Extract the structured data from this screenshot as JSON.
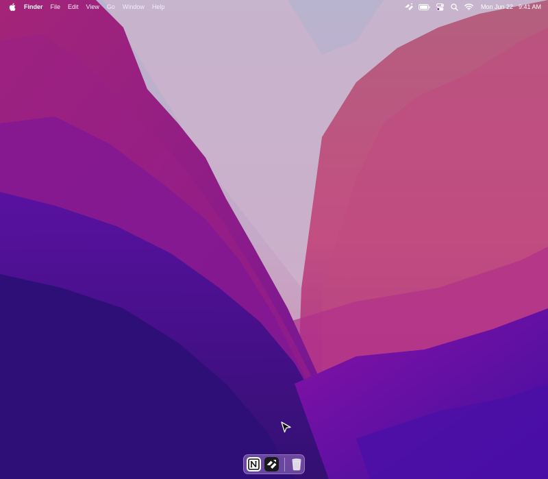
{
  "menubar": {
    "apple_icon": "apple-logo-icon",
    "app_name": "Finder",
    "menus": [
      "File",
      "Edit",
      "View",
      "Go",
      "Window",
      "Help"
    ],
    "status_icons": [
      "pixelmator-icon",
      "battery-icon",
      "control-center-icon",
      "spotlight-search-icon",
      "wifi-icon"
    ],
    "date": "Mon Jun 22",
    "time": "9:41 AM"
  },
  "dock": {
    "apps": [
      {
        "name": "Notion",
        "icon": "notion-icon",
        "label": "N"
      },
      {
        "name": "Pixelmator",
        "icon": "pixelmator-icon"
      }
    ],
    "trash": {
      "name": "Trash",
      "icon": "trash-icon"
    }
  },
  "colors": {
    "wallpaper_top": "#c9b8d8",
    "wallpaper_magenta": "#b0247f",
    "wallpaper_deep": "#3a0d80",
    "wallpaper_right": "#c85088"
  }
}
